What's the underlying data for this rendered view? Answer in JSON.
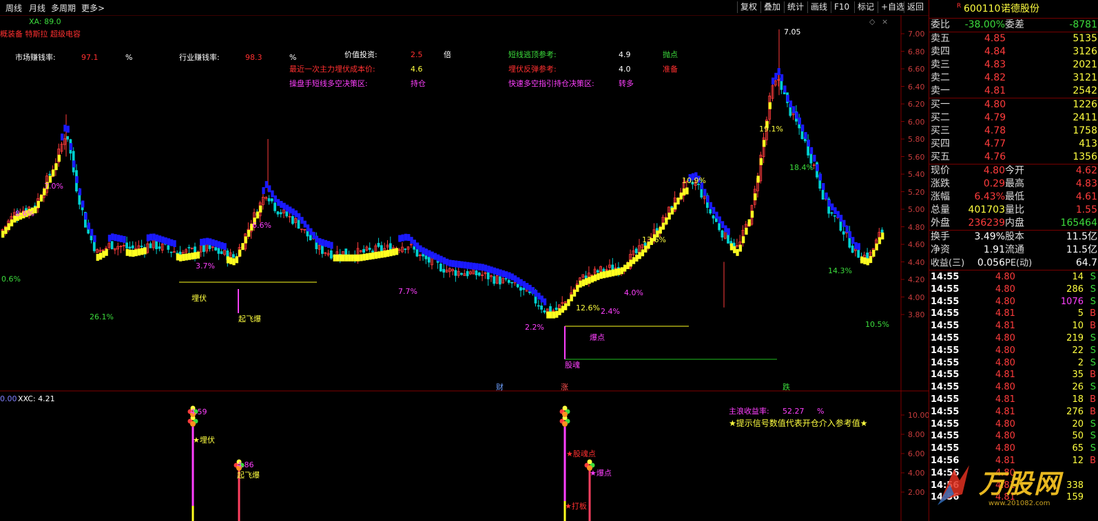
{
  "toolbar": {
    "left": [
      "周线",
      "月线",
      "多周期",
      "更多>"
    ],
    "right": [
      "复权",
      "叠加",
      "统计",
      "画线",
      "F10",
      "标记",
      "+自选",
      "返回"
    ]
  },
  "chart": {
    "indicator_name": "XA: 89.0",
    "concepts": "概装备 特斯拉 超级电容",
    "info": {
      "market_rate_label": "市场赚钱率:",
      "market_rate_value": "97.1",
      "market_rate_unit": "%",
      "industry_rate_label": "行业赚钱率:",
      "industry_rate_value": "98.3",
      "industry_rate_unit": "%",
      "value_label": "价值投资:",
      "value_value": "2.5",
      "value_unit": "倍",
      "cost_label": "最近一次主力埋伏成本价:",
      "cost_value": "4.6",
      "operator_label": "操盘手短线多空决策区:",
      "operator_value": "持仓",
      "escape_label": "短线逃顶参考:",
      "escape_value": "4.9",
      "escape_signal": "抛点",
      "rebound_label": "埋伏反弹参考:",
      "rebound_value": "4.0",
      "rebound_signal": "准备",
      "quick_label": "快速多空指引持仓决策区:",
      "quick_value": "转多"
    },
    "price_axis": [
      "7.00",
      "6.80",
      "6.60",
      "6.40",
      "6.20",
      "6.00",
      "5.80",
      "5.60",
      "5.40",
      "5.20",
      "5.00",
      "4.80",
      "4.60",
      "4.40",
      "4.20",
      "4.00",
      "3.80"
    ],
    "high_marker": "7.05",
    "pct_labels": [
      "8.6%",
      "7.0%",
      "0.6%",
      "26.1%",
      "3.7%",
      "6.6%",
      "7.7%",
      "2.2%",
      "12.6%",
      "2.4%",
      "4.0%",
      "13.6%",
      "10.9%",
      "19.1%",
      "18.4%",
      "14.3%",
      "10.5%"
    ],
    "signal_labels": [
      "埋伏",
      "起飞爆",
      "爆点",
      "股魂"
    ],
    "bottom_markers": [
      "财",
      "涨",
      "跌"
    ]
  },
  "sub_chart": {
    "header": "XXC: 4.21",
    "header_prefix": "0.00",
    "axis": [
      "10.00",
      "8.00",
      "6.00",
      "4.00",
      "2.00"
    ],
    "main_rate_label": "主浪收益率:",
    "main_rate_value": "52.27",
    "main_rate_unit": "%",
    "hint": "★提示信号数值代表开仓介入参考值★",
    "signal_values": [
      "4.59",
      "4.86"
    ],
    "signals": [
      "★埋伏",
      "起飞爆",
      "★股魂点",
      "★打板",
      "★爆点"
    ]
  },
  "quote": {
    "code": "600110",
    "name": "诺德股份",
    "badge": "R",
    "weibi_label": "委比",
    "weibi_value": "-38.00%",
    "weicha_label": "委差",
    "weicha_value": "-8781",
    "asks": [
      {
        "label": "卖五",
        "price": "4.85",
        "vol": "5135"
      },
      {
        "label": "卖四",
        "price": "4.84",
        "vol": "3126"
      },
      {
        "label": "卖三",
        "price": "4.83",
        "vol": "2021"
      },
      {
        "label": "卖二",
        "price": "4.82",
        "vol": "3121"
      },
      {
        "label": "卖一",
        "price": "4.81",
        "vol": "2542"
      }
    ],
    "bids": [
      {
        "label": "买一",
        "price": "4.80",
        "vol": "1226"
      },
      {
        "label": "买二",
        "price": "4.79",
        "vol": "2411"
      },
      {
        "label": "买三",
        "price": "4.78",
        "vol": "1758"
      },
      {
        "label": "买四",
        "price": "4.77",
        "vol": "413"
      },
      {
        "label": "买五",
        "price": "4.76",
        "vol": "1356"
      }
    ],
    "stats": [
      {
        "l1": "现价",
        "v1": "4.80",
        "l2": "今开",
        "v2": "4.62"
      },
      {
        "l1": "涨跌",
        "v1": "0.29",
        "l2": "最高",
        "v2": "4.83"
      },
      {
        "l1": "涨幅",
        "v1": "6.43%",
        "l2": "最低",
        "v2": "4.61"
      },
      {
        "l1": "总量",
        "v1": "401703",
        "l2": "量比",
        "v2": "1.55"
      },
      {
        "l1": "外盘",
        "v1": "236239",
        "l2": "内盘",
        "v2": "165464"
      }
    ],
    "fund": [
      {
        "l1": "换手",
        "v1": "3.49%",
        "l2": "股本",
        "v2": "11.5亿"
      },
      {
        "l1": "净资",
        "v1": "1.91",
        "l2": "流通",
        "v2": "11.5亿"
      },
      {
        "l1": "收益(三)",
        "v1": "0.056",
        "l2": "PE(动)",
        "v2": "64.7"
      }
    ],
    "ticks": [
      {
        "t": "14:55",
        "p": "4.80",
        "v": "14",
        "s": "S"
      },
      {
        "t": "14:55",
        "p": "4.80",
        "v": "286",
        "s": "S"
      },
      {
        "t": "14:55",
        "p": "4.80",
        "v": "1076",
        "s": "S"
      },
      {
        "t": "14:55",
        "p": "4.81",
        "v": "5",
        "s": "B"
      },
      {
        "t": "14:55",
        "p": "4.81",
        "v": "10",
        "s": "B"
      },
      {
        "t": "14:55",
        "p": "4.80",
        "v": "219",
        "s": "S"
      },
      {
        "t": "14:55",
        "p": "4.80",
        "v": "22",
        "s": "S"
      },
      {
        "t": "14:55",
        "p": "4.80",
        "v": "2",
        "s": "S"
      },
      {
        "t": "14:55",
        "p": "4.81",
        "v": "35",
        "s": "B"
      },
      {
        "t": "14:55",
        "p": "4.80",
        "v": "26",
        "s": "S"
      },
      {
        "t": "14:55",
        "p": "4.81",
        "v": "18",
        "s": "B"
      },
      {
        "t": "14:55",
        "p": "4.81",
        "v": "276",
        "s": "B"
      },
      {
        "t": "14:55",
        "p": "4.80",
        "v": "20",
        "s": "S"
      },
      {
        "t": "14:55",
        "p": "4.80",
        "v": "50",
        "s": "S"
      },
      {
        "t": "14:55",
        "p": "4.80",
        "v": "65",
        "s": "S"
      },
      {
        "t": "14:56",
        "p": "4.81",
        "v": "12",
        "s": "B"
      },
      {
        "t": "14:56",
        "p": "4.80",
        "v": "",
        "s": ""
      },
      {
        "t": "14:56",
        "p": "4.81",
        "v": "338",
        "s": ""
      },
      {
        "t": "14:56",
        "p": "4.81",
        "v": "159",
        "s": ""
      }
    ],
    "watermark": "万股网",
    "watermark_url": "www.201082.com"
  }
}
